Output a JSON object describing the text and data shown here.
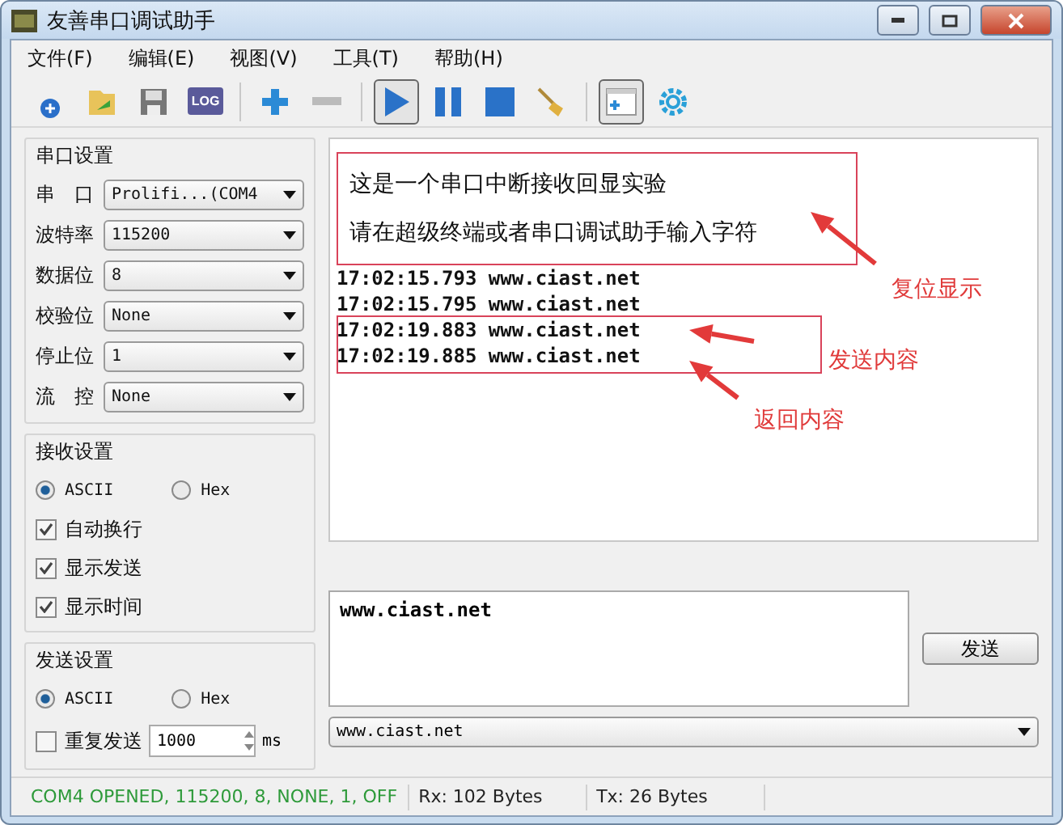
{
  "window": {
    "title": "友善串口调试助手"
  },
  "menu": [
    "文件(F)",
    "编辑(E)",
    "视图(V)",
    "工具(T)",
    "帮助(H)"
  ],
  "toolbar": [
    {
      "kind": "new",
      "pressed": false
    },
    {
      "kind": "open",
      "pressed": false
    },
    {
      "kind": "save",
      "pressed": false
    },
    {
      "kind": "log",
      "label": "LOG",
      "pressed": false
    },
    {
      "kind": "separator"
    },
    {
      "kind": "add",
      "pressed": false
    },
    {
      "kind": "remove",
      "pressed": false
    },
    {
      "kind": "separator"
    },
    {
      "kind": "play",
      "pressed": true
    },
    {
      "kind": "pause",
      "pressed": false
    },
    {
      "kind": "stop",
      "pressed": false
    },
    {
      "kind": "clear",
      "pressed": false
    },
    {
      "kind": "separator"
    },
    {
      "kind": "panel",
      "pressed": true
    },
    {
      "kind": "settings",
      "pressed": false
    }
  ],
  "serial_settings": {
    "title": "串口设置",
    "fields": [
      {
        "label": "串　口",
        "value": "Prolifi...(COM4"
      },
      {
        "label": "波特率",
        "value": "115200"
      },
      {
        "label": "数据位",
        "value": "8"
      },
      {
        "label": "校验位",
        "value": "None"
      },
      {
        "label": "停止位",
        "value": "1"
      },
      {
        "label": "流　控",
        "value": "None"
      }
    ]
  },
  "receive_settings": {
    "title": "接收设置",
    "modes": [
      {
        "label": "ASCII",
        "selected": true
      },
      {
        "label": "Hex",
        "selected": false
      }
    ],
    "options": [
      {
        "label": "自动换行",
        "checked": true
      },
      {
        "label": "显示发送",
        "checked": true
      },
      {
        "label": "显示时间",
        "checked": true
      }
    ]
  },
  "send_settings": {
    "title": "发送设置",
    "modes": [
      {
        "label": "ASCII",
        "selected": true
      },
      {
        "label": "Hex",
        "selected": false
      }
    ],
    "repeat": {
      "label": "重复发送",
      "checked": false,
      "interval": "1000",
      "unit": "ms"
    }
  },
  "log": {
    "lines": [
      {
        "kind": "message",
        "text": "这是一个串口中断接收回显实验"
      },
      {
        "kind": "message",
        "text": "请在超级终端或者串口调试助手输入字符"
      },
      {
        "kind": "data",
        "text": "17:02:15.793 www.ciast.net"
      },
      {
        "kind": "data",
        "text": "17:02:15.795 www.ciast.net"
      },
      {
        "kind": "data",
        "text": "17:02:19.883 www.ciast.net"
      },
      {
        "kind": "data",
        "text": "17:02:19.885 www.ciast.net"
      }
    ]
  },
  "annotations": [
    {
      "text": "复位显示"
    },
    {
      "text": "发送内容"
    },
    {
      "text": "返回内容"
    }
  ],
  "send": {
    "value": "www.ciast.net",
    "button": "发送",
    "history": "www.ciast.net"
  },
  "status_bar": [
    {
      "text": "COM4 OPENED, 115200, 8, NONE, 1, OFF",
      "color": "#2e9a3a"
    },
    {
      "text": "Rx: 102 Bytes",
      "color": "#222222"
    },
    {
      "text": "Tx: 26 Bytes",
      "color": "#222222"
    }
  ]
}
